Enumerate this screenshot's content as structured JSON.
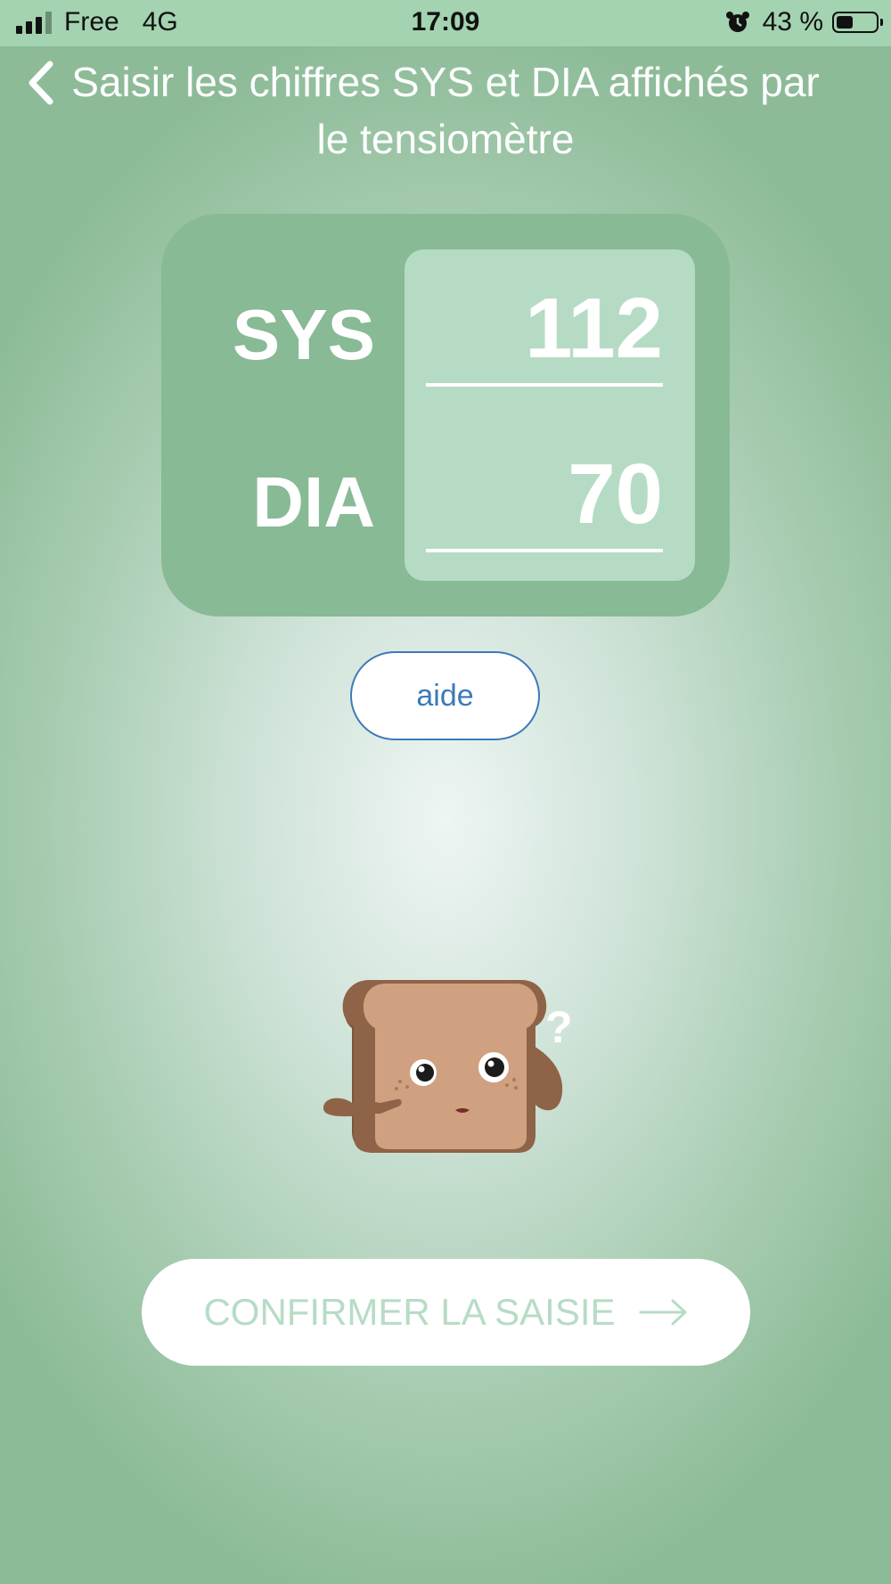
{
  "status_bar": {
    "carrier": "Free",
    "network": "4G",
    "time": "17:09",
    "battery": "43 %"
  },
  "header": {
    "back_icon": "chevron-left-icon",
    "title": "Saisir les chiffres SYS et DIA affichés par le tensiomètre"
  },
  "reading": {
    "sys_label": "SYS",
    "sys_value": "112",
    "dia_label": "DIA",
    "dia_value": "70"
  },
  "help_button": {
    "label": "aide"
  },
  "mascot": {
    "icon": "confused-toast-mascot"
  },
  "confirm_button": {
    "label": "CONFIRMER LA SAISIE",
    "icon": "arrow-right-icon"
  },
  "colors": {
    "card": "#87ba95",
    "panel": "#b6dbc5",
    "help_accent": "#3d7ab8",
    "confirm_text": "#b7dcc4"
  }
}
